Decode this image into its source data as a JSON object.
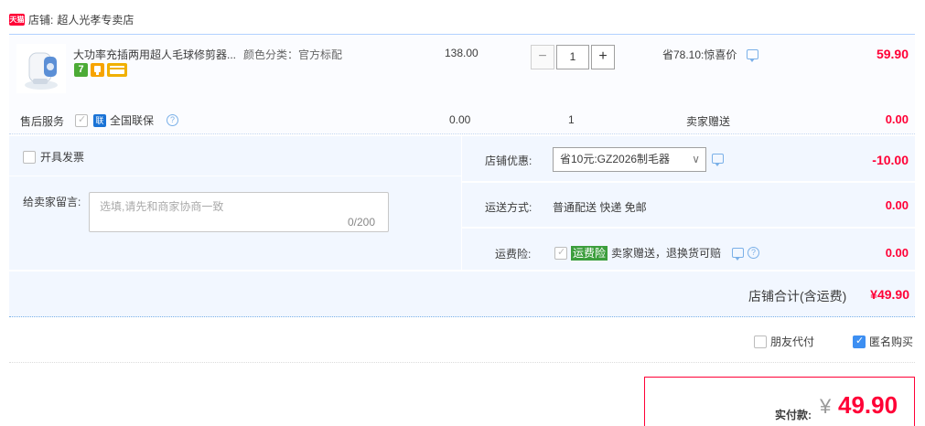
{
  "shop": {
    "badge": "天猫",
    "label": "店铺:",
    "name": "超人光孝专卖店"
  },
  "item": {
    "title": "大功率充插两用超人毛球修剪器...",
    "sku": "颜色分类：官方标配",
    "price": "138.00",
    "quantity": "1",
    "minus": "−",
    "plus": "+",
    "discount": "省78.10:惊喜价",
    "total": "59.90",
    "badges": {
      "seven": "7"
    }
  },
  "service": {
    "label": "售后服务",
    "option": "全国联保",
    "help": "?",
    "lian": "联",
    "price": "0.00",
    "qty": "1",
    "gift": "卖家赠送",
    "total": "0.00"
  },
  "invoice": {
    "label": "开具发票"
  },
  "message": {
    "label": "给卖家留言:",
    "placeholder": "选填,请先和商家协商一致",
    "count": "0/200"
  },
  "coupon": {
    "label": "店铺优惠:",
    "selected": "省10元:GZ2026制毛器",
    "value": "-10.00"
  },
  "shipping": {
    "label": "运送方式:",
    "method": "普通配送 快递 免邮",
    "value": "0.00"
  },
  "insurance": {
    "label": "运费险:",
    "tag": "运费险",
    "desc": "卖家赠送，退换货可赔",
    "value": "0.00"
  },
  "summary": {
    "label": "店铺合计(含运费)",
    "value": "¥49.90"
  },
  "options": {
    "friend_pay": "朋友代付",
    "anonymous": "匿名购买"
  },
  "payment": {
    "label": "实付款:",
    "currency": "¥",
    "value": "49.90"
  },
  "colors": {
    "accent": "#ff0036",
    "panel": "#f2f7ff",
    "border": "#b2d1ff"
  }
}
